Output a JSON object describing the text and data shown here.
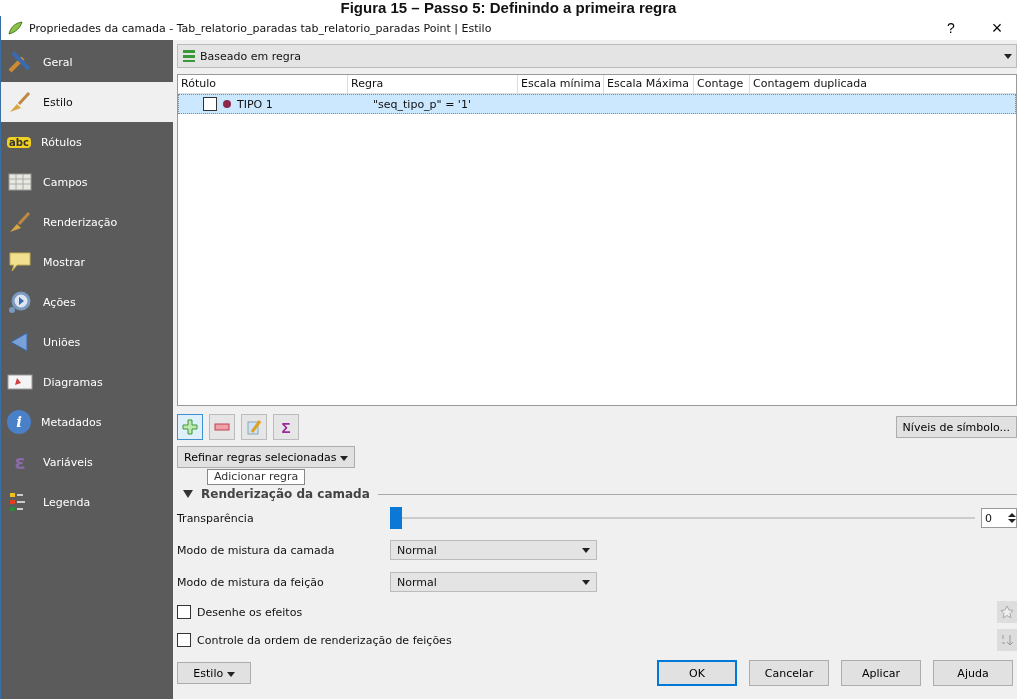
{
  "caption": "Figura 15 – Passo 5: Definindo a primeira regra",
  "window": {
    "title": "Propriedades da camada - Tab_relatorio_paradas tab_relatorio_paradas Point | Estilo",
    "help": "?",
    "close": "×"
  },
  "sidebar": {
    "items": [
      {
        "label": "Geral",
        "selected": false
      },
      {
        "label": "Estilo",
        "selected": true
      },
      {
        "label": "Rótulos",
        "selected": false,
        "badge": "abc"
      },
      {
        "label": "Campos",
        "selected": false
      },
      {
        "label": "Renderização",
        "selected": false
      },
      {
        "label": "Mostrar",
        "selected": false
      },
      {
        "label": "Ações",
        "selected": false
      },
      {
        "label": "Uniões",
        "selected": false
      },
      {
        "label": "Diagramas",
        "selected": false
      },
      {
        "label": "Metadados",
        "selected": false,
        "badge": "i"
      },
      {
        "label": "Variáveis",
        "selected": false,
        "badge": "ε"
      },
      {
        "label": "Legenda",
        "selected": false
      }
    ]
  },
  "renderer": {
    "label": "Baseado em regra"
  },
  "table": {
    "columns": [
      "Rótulo",
      "Regra",
      "Escala mínima",
      "Escala Máxima",
      "Contage",
      "Contagem duplicada"
    ],
    "rows": [
      {
        "checked": false,
        "color": "#8b2a4a",
        "label": "TIPO 1",
        "rule": "\"seq_tipo_p\"  = '1'",
        "selected": true
      }
    ]
  },
  "toolbar": {
    "sigma": "Σ"
  },
  "symbol_levels_button": "Níveis de símbolo...",
  "refine_button": "Refinar regras selecionadas",
  "tooltip": "Adicionar regra",
  "section": {
    "title": "Renderização da camada",
    "expanded": true
  },
  "transparency": {
    "label": "Transparência",
    "level": 0,
    "value": "0"
  },
  "blend_modes": [
    {
      "label": "Modo de mistura da camada",
      "value": "Normal"
    },
    {
      "label": "Modo de mistura da feição",
      "value": "Normal"
    }
  ],
  "options": [
    {
      "label": "Desenhe os efeitos",
      "checked": false
    },
    {
      "label": "Controle da ordem de renderização de feições",
      "checked": false
    }
  ],
  "style_button": "Estilo",
  "buttons": [
    {
      "label": "OK",
      "default": true
    },
    {
      "label": "Cancelar",
      "default": false
    },
    {
      "label": "Aplicar",
      "default": false
    },
    {
      "label": "Ajuda",
      "default": false
    }
  ]
}
